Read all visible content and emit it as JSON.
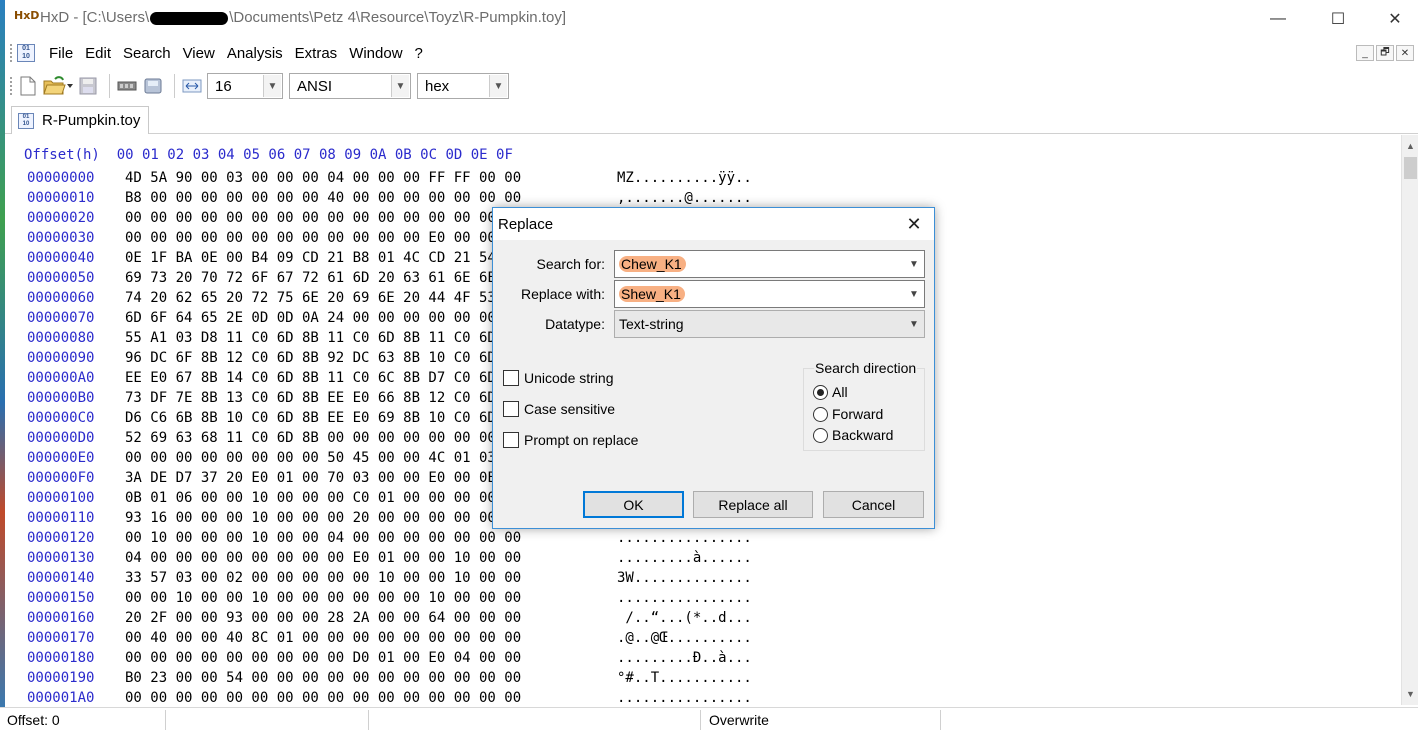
{
  "window": {
    "app_name": "HxD -",
    "path_prefix": "[C:\\Users\\",
    "path_suffix": "\\Documents\\Petz 4\\Resource\\Toyz\\R-Pumpkin.toy]",
    "app_icon": "HxD",
    "minimize": "—",
    "maximize": "☐",
    "close": "✕"
  },
  "menu": {
    "items": [
      "File",
      "Edit",
      "Search",
      "View",
      "Analysis",
      "Extras",
      "Window",
      "?"
    ],
    "mdi": [
      "_",
      "🗗",
      "✕"
    ]
  },
  "toolbar": {
    "bytes_per_row": "16",
    "charset": "ANSI",
    "number_format": "hex"
  },
  "tab": {
    "label": "R-Pumpkin.toy"
  },
  "hex": {
    "header_offset": "Offset(h)",
    "header_columns": "00 01 02 03 04 05 06 07 08 09 0A 0B 0C 0D 0E 0F",
    "rows": [
      {
        "o": "00000000",
        "b": "4D 5A 90 00 03 00 00 00 04 00 00 00 FF FF 00 00",
        "t": "MZ..........ÿÿ.."
      },
      {
        "o": "00000010",
        "b": "B8 00 00 00 00 00 00 00 40 00 00 00 00 00 00 00",
        "t": ",.......@......."
      },
      {
        "o": "00000020",
        "b": "00 00 00 00 00 00 00 00 00 00 00 00 00 00 00 00",
        "t": "................"
      },
      {
        "o": "00000030",
        "b": "00 00 00 00 00 00 00 00 00 00 00 00 E0 00 00 00",
        "t": "............à..."
      },
      {
        "o": "00000040",
        "b": "0E 1F BA 0E 00 B4 09 CD 21 B8 01 4C CD 21 54 68",
        "t": "..º..´.Í!¸.LÍ!Th"
      },
      {
        "o": "00000050",
        "b": "69 73 20 70 72 6F 67 72 61 6D 20 63 61 6E 6E 6F",
        "t": "is program canno"
      },
      {
        "o": "00000060",
        "b": "74 20 62 65 20 72 75 6E 20 69 6E 20 44 4F 53 20",
        "t": "t be run in DOS "
      },
      {
        "o": "00000070",
        "b": "6D 6F 64 65 2E 0D 0D 0A 24 00 00 00 00 00 00 00",
        "t": "mode....$......."
      },
      {
        "o": "00000080",
        "b": "55 A1 03 D8 11 C0 6D 8B 11 C0 6D 8B 11 C0 6D 8B",
        "t": "U¡.Ø.Àm‹.Àm‹.Àm‹"
      },
      {
        "o": "00000090",
        "b": "96 DC 6F 8B 12 C0 6D 8B 92 DC 63 8B 10 C0 6D 8B",
        "t": "–Üo‹.Àm‹’Üc‹.Àm‹"
      },
      {
        "o": "000000A0",
        "b": "EE E0 67 8B 14 C0 6D 8B 11 C0 6C 8B D7 C0 6D 8B",
        "t": "îàg‹.Àm‹.Àl‹×Àm‹"
      },
      {
        "o": "000000B0",
        "b": "73 DF 7E 8B 13 C0 6D 8B EE E0 66 8B 12 C0 6D 8B",
        "t": "sß~‹.Àm‹îàf‹.Àm‹"
      },
      {
        "o": "000000C0",
        "b": "D6 C6 6B 8B 10 C0 6D 8B EE E0 69 8B 10 C0 6D 8B",
        "t": "ÖÆk‹.Àm‹îài‹.Àm‹"
      },
      {
        "o": "000000D0",
        "b": "52 69 63 68 11 C0 6D 8B 00 00 00 00 00 00 00 00",
        "t": "Rich.Àm‹........"
      },
      {
        "o": "000000E0",
        "b": "00 00 00 00 00 00 00 00 50 45 00 00 4C 01 03 00",
        "t": "........PE..L..."
      },
      {
        "o": "000000F0",
        "b": "3A DE D7 37 20 E0 01 00 70 03 00 00 E0 00 0E 21",
        "t": ":Þ×7 à..p...à..!"
      },
      {
        "o": "00000100",
        "b": "0B 01 06 00 00 10 00 00 00 C0 01 00 00 00 00 00",
        "t": ".........À......"
      },
      {
        "o": "00000110",
        "b": "93 16 00 00 00 10 00 00 00 20 00 00 00 00 00 10",
        "t": "“........ ......"
      },
      {
        "o": "00000120",
        "b": "00 10 00 00 00 10 00 00 04 00 00 00 00 00 00 00",
        "t": "................"
      },
      {
        "o": "00000130",
        "b": "04 00 00 00 00 00 00 00 00 E0 01 00 00 10 00 00",
        "t": ".........à......"
      },
      {
        "o": "00000140",
        "b": "33 57 03 00 02 00 00 00 00 00 10 00 00 10 00 00",
        "t": "3W.............."
      },
      {
        "o": "00000150",
        "b": "00 00 10 00 00 10 00 00 00 00 00 00 10 00 00 00",
        "t": "................"
      },
      {
        "o": "00000160",
        "b": "20 2F 00 00 93 00 00 00 28 2A 00 00 64 00 00 00",
        "t": " /..“...(*..d..."
      },
      {
        "o": "00000170",
        "b": "00 40 00 00 40 8C 01 00 00 00 00 00 00 00 00 00",
        "t": ".@..@Œ.........."
      },
      {
        "o": "00000180",
        "b": "00 00 00 00 00 00 00 00 00 D0 01 00 E0 04 00 00",
        "t": ".........Ð..à..."
      },
      {
        "o": "00000190",
        "b": "B0 23 00 00 54 00 00 00 00 00 00 00 00 00 00 00",
        "t": "°#..T..........."
      },
      {
        "o": "000001A0",
        "b": "00 00 00 00 00 00 00 00 00 00 00 00 00 00 00 00",
        "t": "................"
      }
    ]
  },
  "status": {
    "offset": "Offset: 0",
    "mode": "Overwrite"
  },
  "dialog": {
    "title": "Replace",
    "close": "✕",
    "search_label": "Search for:",
    "search_value": "Chew_K1",
    "replace_label": "Replace with:",
    "replace_value": "Shew_K1",
    "datatype_label": "Datatype:",
    "datatype_value": "Text-string",
    "unicode": "Unicode string",
    "case": "Case sensitive",
    "prompt": "Prompt on replace",
    "direction_title": "Search direction",
    "dir_all": "All",
    "dir_forward": "Forward",
    "dir_backward": "Backward",
    "ok": "OK",
    "replace_all": "Replace all",
    "cancel": "Cancel"
  }
}
